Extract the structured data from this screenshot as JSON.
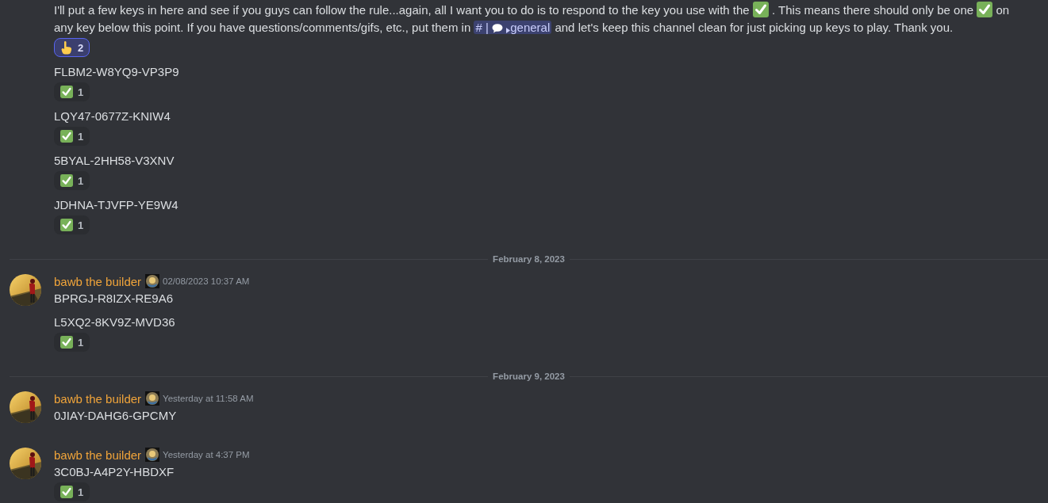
{
  "messages": [
    {
      "kind": "message",
      "lines": [
        {
          "kind": "paragraph",
          "parts": [
            {
              "kind": "text",
              "text": "I'll put a few keys in here and see if you guys can follow the rule...again, all I want you to do is to respond to the key you use with the "
            },
            {
              "kind": "check"
            },
            {
              "kind": "text",
              "text": " . This means there should only be one "
            },
            {
              "kind": "check"
            },
            {
              "kind": "text",
              "text": "  on any key below this point. If you have questions/comments/gifs, etc., put them in "
            },
            {
              "kind": "mention",
              "prefix": "#",
              "separator": "|",
              "name": "general"
            },
            {
              "kind": "text",
              "text": " and let's keep this channel clean for just picking up keys to play. Thank you."
            }
          ],
          "reactions": [
            {
              "kind": "hand",
              "count": "2",
              "selected": true
            }
          ]
        },
        {
          "kind": "key",
          "text": "FLBM2-W8YQ9-VP3P9",
          "reactions": [
            {
              "kind": "check",
              "count": "1",
              "selected": false
            }
          ]
        },
        {
          "kind": "key",
          "text": "LQY47-0677Z-KNIW4",
          "reactions": [
            {
              "kind": "check",
              "count": "1",
              "selected": false
            }
          ]
        },
        {
          "kind": "key",
          "text": "5BYAL-2HH58-V3XNV",
          "reactions": [
            {
              "kind": "check",
              "count": "1",
              "selected": false
            }
          ]
        },
        {
          "kind": "key",
          "text": "JDHNA-TJVFP-YE9W4",
          "reactions": [
            {
              "kind": "check",
              "count": "1",
              "selected": false
            }
          ]
        }
      ]
    },
    {
      "kind": "divider",
      "date": "February 8, 2023"
    },
    {
      "kind": "message",
      "author": "bawb the builder",
      "timestamp": "02/08/2023 10:37 AM",
      "lines": [
        {
          "kind": "key",
          "text": "BPRGJ-R8IZX-RE9A6"
        },
        {
          "kind": "key",
          "text": "L5XQ2-8KV9Z-MVD36",
          "reactions": [
            {
              "kind": "check",
              "count": "1",
              "selected": false
            }
          ]
        }
      ]
    },
    {
      "kind": "divider",
      "date": "February 9, 2023"
    },
    {
      "kind": "message",
      "author": "bawb the builder",
      "timestamp": "Yesterday at 11:58 AM",
      "lines": [
        {
          "kind": "key",
          "text": "0JIAY-DAHG6-GPCMY"
        }
      ]
    },
    {
      "kind": "message",
      "author": "bawb the builder",
      "timestamp": "Yesterday at 4:37 PM",
      "lines": [
        {
          "kind": "key",
          "text": "3C0BJ-A4P2Y-HBDXF",
          "reactions": [
            {
              "kind": "check",
              "count": "1",
              "selected": false
            }
          ]
        }
      ]
    }
  ]
}
